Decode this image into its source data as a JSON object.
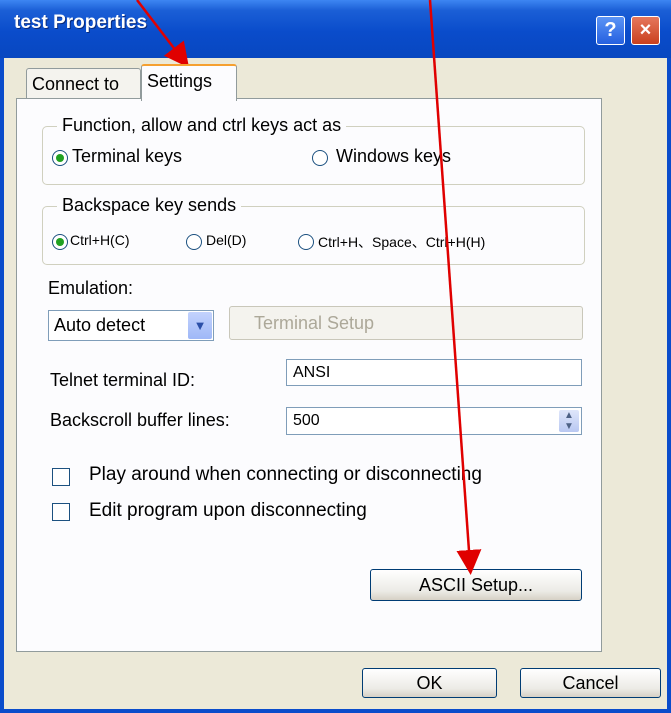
{
  "window": {
    "title": "test Properties",
    "help_label": "?",
    "close_label": "×"
  },
  "tabs": [
    {
      "label": "Connect to",
      "active": false
    },
    {
      "label": "Settings",
      "active": true
    }
  ],
  "function_keys": {
    "legend": "Function, allow and ctrl keys act as",
    "options": [
      {
        "label": "Terminal keys",
        "selected": true
      },
      {
        "label": "Windows keys",
        "selected": false
      }
    ]
  },
  "backspace": {
    "legend": "Backspace key sends",
    "options": [
      {
        "label": "Ctrl+H(C)",
        "selected": true
      },
      {
        "label": "Del(D)",
        "selected": false
      },
      {
        "label": "Ctrl+H、Space、Ctrl+H(H)",
        "selected": false
      }
    ]
  },
  "emulation": {
    "label": "Emulation:",
    "value": "Auto detect",
    "terminal_setup_label": "Terminal Setup"
  },
  "telnet": {
    "label": "Telnet terminal ID:",
    "value": "ANSI"
  },
  "backscroll": {
    "label": "Backscroll buffer lines:",
    "value": "500"
  },
  "options": [
    {
      "label": "Play around when connecting or disconnecting",
      "checked": false
    },
    {
      "label": "Edit program upon disconnecting",
      "checked": false
    }
  ],
  "ascii_setup_label": "ASCII Setup...",
  "footer": {
    "ok_label": "OK",
    "cancel_label": "Cancel"
  },
  "colors": {
    "title_bar": "#0a4ccb",
    "annotation_arrow": "#e00000",
    "tab_highlight": "#f5a030"
  }
}
